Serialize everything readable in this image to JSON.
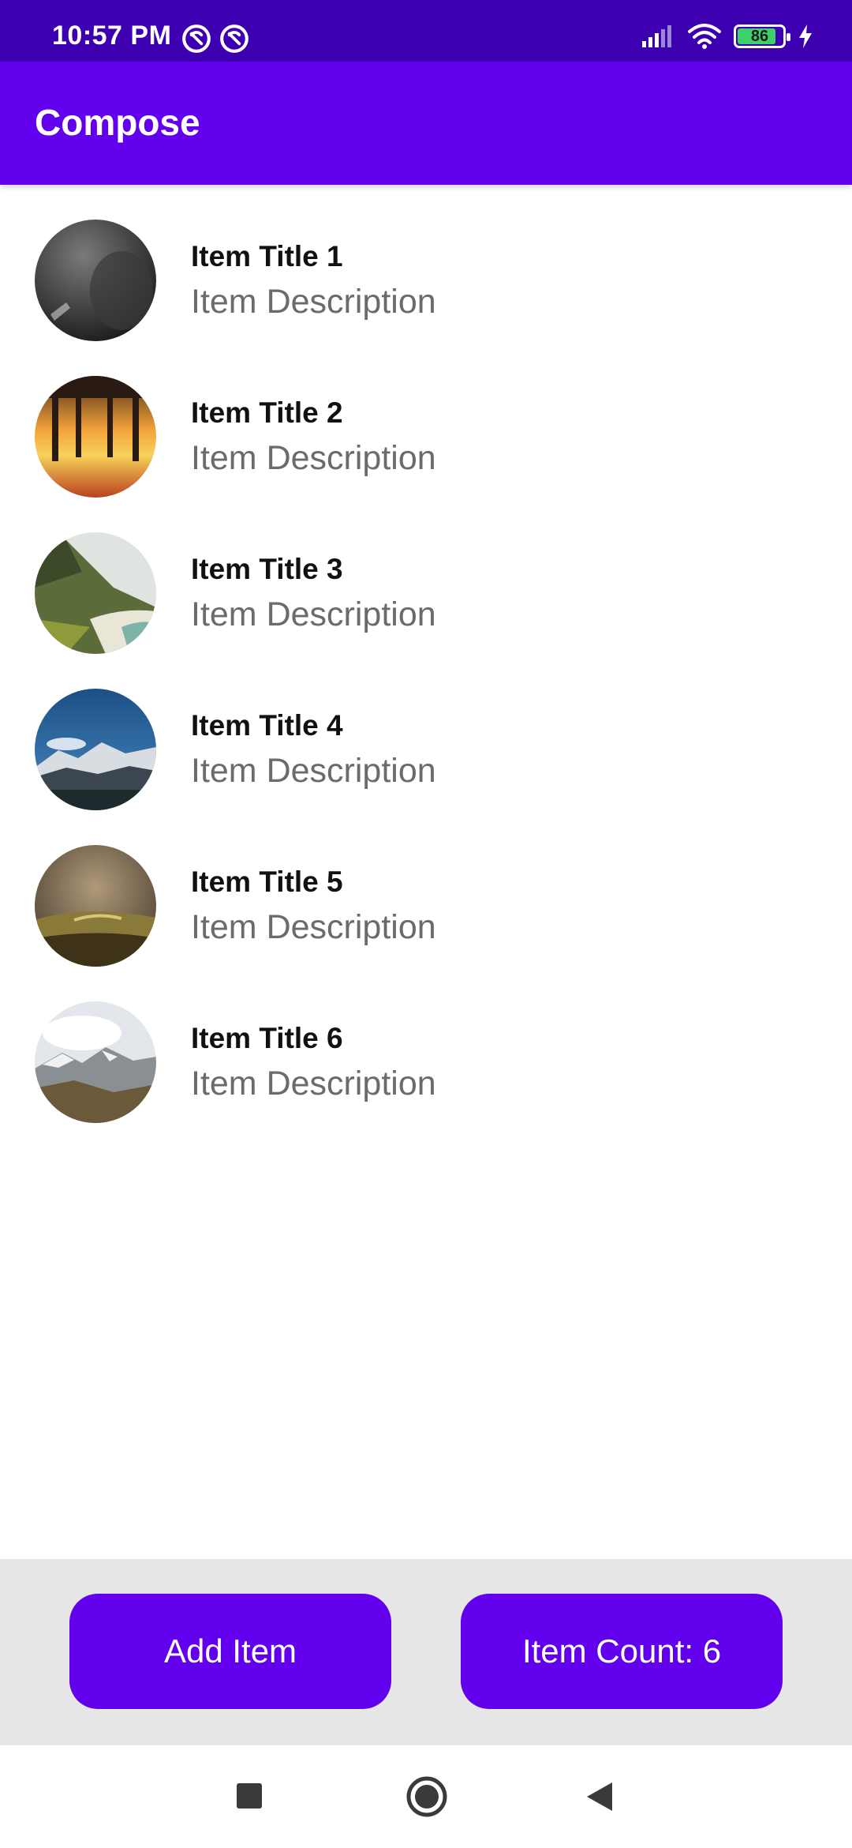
{
  "status_bar": {
    "time": "10:57 PM",
    "battery_level": "86",
    "battery_percent": 86,
    "icons": [
      "notification-icon",
      "notification-icon",
      "signal-icon",
      "wifi-icon",
      "battery-icon",
      "charging-icon"
    ]
  },
  "app_bar": {
    "title": "Compose",
    "color": "#6200ee"
  },
  "items": [
    {
      "title": "Item Title 1",
      "description": "Item Description",
      "image": "dark-ocean-photo"
    },
    {
      "title": "Item Title 2",
      "description": "Item Description",
      "image": "pier-sunset-photo"
    },
    {
      "title": "Item Title 3",
      "description": "Item Description",
      "image": "coastal-cliff-photo"
    },
    {
      "title": "Item Title 4",
      "description": "Item Description",
      "image": "snowy-mountain-photo"
    },
    {
      "title": "Item Title 5",
      "description": "Item Description",
      "image": "hill-storm-photo"
    },
    {
      "title": "Item Title 6",
      "description": "Item Description",
      "image": "cloudy-peaks-photo"
    }
  ],
  "actions": {
    "add_label": "Add Item",
    "count_label": "Item Count: 6"
  },
  "nav_bar": {
    "icons": [
      "recents-square-icon",
      "home-circle-icon",
      "back-triangle-icon"
    ]
  }
}
